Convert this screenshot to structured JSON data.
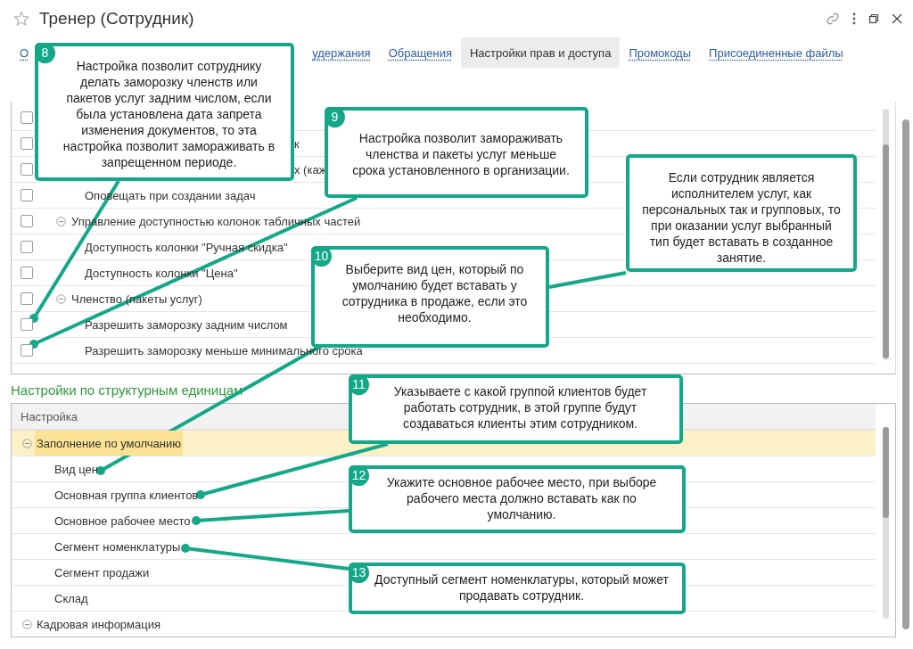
{
  "window": {
    "title": "Тренер (Сотрудник)",
    "favorite": false
  },
  "tabs": [
    {
      "label": "О",
      "selected": false
    },
    {
      "label": "удержания",
      "selected": false
    },
    {
      "label": "Обращения",
      "selected": false
    },
    {
      "label": "Настройки прав и доступа",
      "selected": true
    },
    {
      "label": "Промокоды",
      "selected": false
    },
    {
      "label": "Присоединенные файлы",
      "selected": false
    }
  ],
  "rights_table": {
    "rows": [
      {
        "kind": "partial",
        "checked": false
      },
      {
        "kind": "partial",
        "label": "к",
        "checked": false
      },
      {
        "kind": "partial",
        "label": "х (каж",
        "checked": false
      },
      {
        "kind": "item",
        "label": "Оповещать при создании задач",
        "checked": false
      },
      {
        "kind": "group",
        "label": "Управление доступностью колонок табличных частей",
        "checked": false,
        "expanded": true,
        "children": [
          {
            "kind": "item",
            "label": "Доступность колонки \"Ручная скидка\"",
            "checked": false
          },
          {
            "kind": "item",
            "label": "Доступность колонки \"Цена\"",
            "checked": false
          }
        ]
      },
      {
        "kind": "group",
        "label": "Членство (пакеты услуг)",
        "checked": false,
        "expanded": true,
        "children": [
          {
            "kind": "item",
            "label": "Разрешить заморозку задним числом",
            "checked": false
          },
          {
            "kind": "item",
            "label": "Разрешить заморозку меньше минимального срока",
            "checked": false
          }
        ]
      }
    ]
  },
  "units_section": {
    "title": "Настройки по структурным единицам",
    "table": {
      "columns": [
        "Настройка"
      ],
      "rows": [
        {
          "kind": "group",
          "label": "Заполнение по умолчанию",
          "expanded": true,
          "selected": true,
          "children": [
            {
              "kind": "item",
              "label": "Вид цен",
              "selected": false
            },
            {
              "kind": "item",
              "label": "Основная группа клиентов",
              "selected": false
            },
            {
              "kind": "item",
              "label": "Основное рабочее место",
              "selected": false
            },
            {
              "kind": "item",
              "label": "Сегмент номенклатуры",
              "selected": false
            },
            {
              "kind": "item",
              "label": "Сегмент продажи",
              "selected": false
            },
            {
              "kind": "item",
              "label": "Склад",
              "selected": false
            }
          ]
        },
        {
          "kind": "group",
          "label": "Кадровая информация",
          "expanded": true,
          "selected": false
        }
      ]
    }
  },
  "callouts": [
    {
      "number": "8",
      "text": "Настройка позволит сотруднику делать заморозку членств или пакетов услуг задним числом, если была установлена дата запрета изменения документов, то эта настройка позволит замораживать в запрещенном периоде."
    },
    {
      "number": "9",
      "text": "Настройка позволит замораживать членства и пакеты услуг меньше срока установленного в организации."
    },
    {
      "number": "10",
      "text": "Выберите вид цен, который по умолчанию будет вставать у сотрудника в продаже, если это необходимо."
    },
    {
      "text": "Если сотрудник является исполнителем услуг, как персональных так и групповых, то при оказании услуг выбранный тип будет вставать в созданное занятие."
    },
    {
      "number": "11",
      "text": "Указываете с какой группой клиентов будет работать сотрудник, в этой группе будут создаваться клиенты этим сотрудником."
    },
    {
      "number": "12",
      "text": "Укажите основное рабочее место, при выборе рабочего места должно вставать как по умолчанию."
    },
    {
      "number": "13",
      "text": "Доступный сегмент номенклатуры, который может продавать сотрудник."
    }
  ]
}
